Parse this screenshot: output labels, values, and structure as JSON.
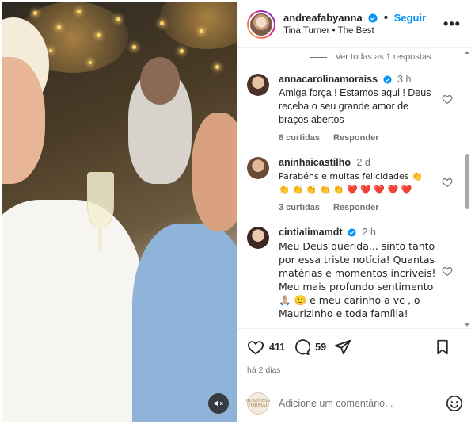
{
  "post": {
    "author": "andreafabyanna",
    "follow_label": "Seguir",
    "song_artist": "Tina Turner",
    "song_title": "The Best",
    "song_separator": "•",
    "more_label": "•••"
  },
  "comments": {
    "view_replies_label": "Ver todas as 1 respostas",
    "items": [
      {
        "user": "annacarolinamoraiss",
        "time": "3 h",
        "verified": true,
        "text": "Amiga força ! Estamos aqui ! Deus receba o seu grande amor de braços abertos",
        "likes": "8 curtidas",
        "reply": "Responder"
      },
      {
        "user": "aninhaicastilho",
        "time": "2 d",
        "verified": false,
        "text": "Parabéns e muitas felicidades 👏",
        "emoji_line": "👏 👏 👏 👏 👏 ❤️ ❤️ ❤️ ❤️ ❤️",
        "likes": "3 curtidas",
        "reply": "Responder"
      },
      {
        "user": "cintialimamdt",
        "time": "2 h",
        "verified": true,
        "text": "Meu Deus querida... sinto tanto por essa triste notícia! Quantas matérias e momentos incríveis! Meu mais profundo sentimento 🙏🏼 🙂 e meu carinho a vc , o Maurizinho e toda família!",
        "likes": "",
        "reply": ""
      }
    ]
  },
  "actions": {
    "likes_count": "411",
    "comments_count": "59",
    "posted_time": "há 2 dias"
  },
  "composer": {
    "placeholder": "Adicione um comentário...",
    "avatar_text": "BUSINESS FORMAL"
  },
  "colors": {
    "link": "#0095f6",
    "verified": "#0095f6",
    "muted": "#737373",
    "border": "#efefef"
  }
}
